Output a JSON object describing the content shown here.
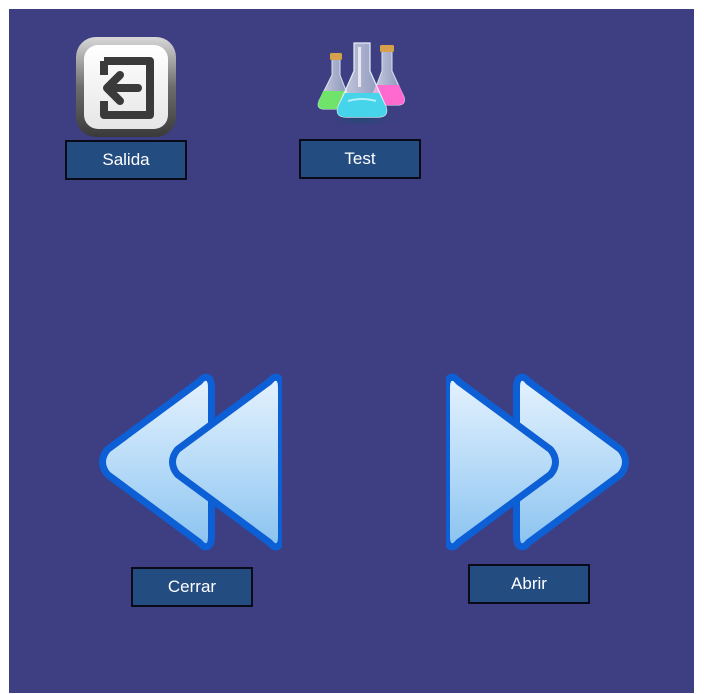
{
  "screen": {
    "background": "#3d3f82"
  },
  "buttons": {
    "exit": {
      "label": "Salida",
      "icon": "exit-door-arrow-icon"
    },
    "test": {
      "label": "Test",
      "icon": "chemistry-flasks-icon"
    },
    "close": {
      "label": "Cerrar",
      "icon": "double-chevron-left-icon"
    },
    "open": {
      "label": "Abrir",
      "icon": "double-chevron-right-icon"
    }
  },
  "colors": {
    "label_bg": "#234c80",
    "label_border": "#0a0a18",
    "arrow_outline": "#0d5fd6",
    "arrow_fill": "#a8d0f5"
  }
}
